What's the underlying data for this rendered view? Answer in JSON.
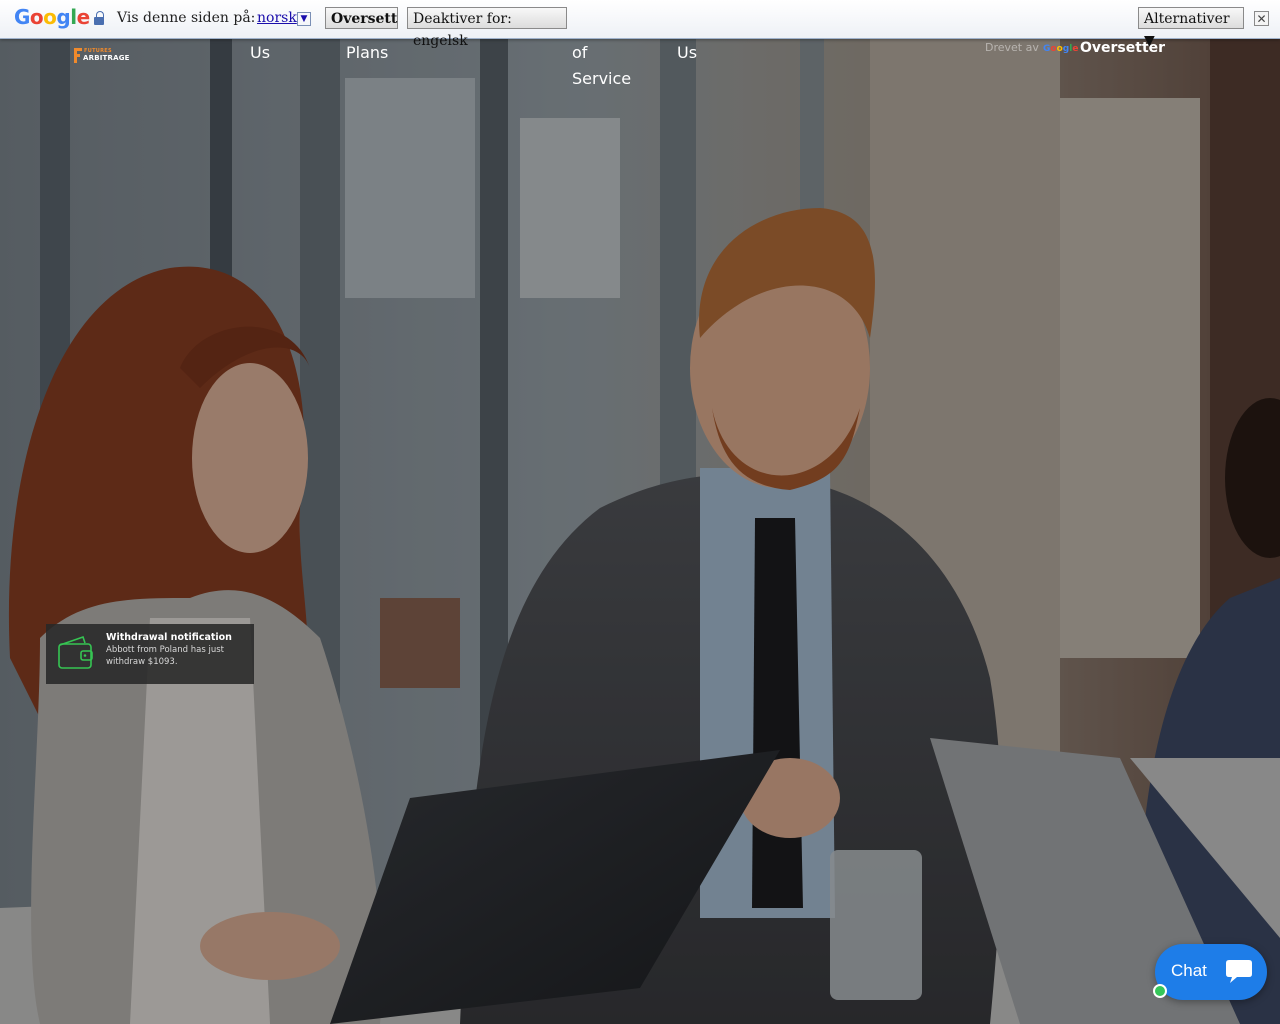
{
  "translate_bar": {
    "logo": "Google",
    "prompt": "Vis denne siden på:",
    "language": "norsk",
    "translate_button": "Oversett",
    "disable_button": "Deaktiver for: engelsk",
    "options_button": "Alternativer ▼",
    "close": "✕"
  },
  "site": {
    "logo_top": "FUTURES",
    "logo_bottom": "ARBITRAGE",
    "nav": [
      "Us",
      "Plans",
      "of\nService",
      "Us"
    ],
    "powered_prefix": "Drevet av",
    "powered_google": "Google",
    "powered_service": "Oversetter"
  },
  "notification": {
    "title": "Withdrawal notification",
    "body": "Abbott from Poland has just withdraw $1093."
  },
  "chat": {
    "label": "Chat",
    "online": true
  },
  "colors": {
    "accent": "#f08a2c",
    "chat": "#1e7de8",
    "online": "#35c659"
  }
}
